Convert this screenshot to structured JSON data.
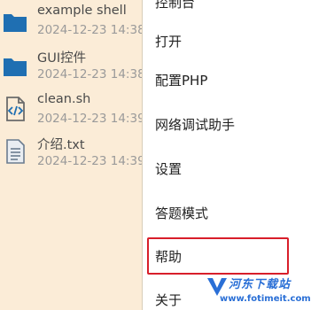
{
  "files": [
    {
      "name": "example shell",
      "date": "2024-12-23 14:38:",
      "icon": "folder-icon"
    },
    {
      "name": "GUI控件",
      "date": "2024-12-23 14:38:",
      "icon": "folder-icon"
    },
    {
      "name": "clean.sh",
      "date": "2024-12-23 14:39:",
      "icon": "code-file-icon"
    },
    {
      "name": "介绍.txt",
      "date": "2024-12-23 14:39:",
      "icon": "text-file-icon"
    }
  ],
  "menu": {
    "partial_top": "控制台",
    "items": [
      "打开",
      "配置PHP",
      "网络调试助手",
      "设置",
      "答题模式",
      "帮助",
      "关于"
    ],
    "highlighted": "帮助"
  },
  "watermark": {
    "text": "河东下载站",
    "url": "www.fotimeit.com"
  },
  "colors": {
    "background": "#fbecd7",
    "menu_background": "#ffffff",
    "folder_blue": "#1f6fb2",
    "highlight_red": "#d81e2a",
    "watermark_blue": "#2a6fd6"
  }
}
